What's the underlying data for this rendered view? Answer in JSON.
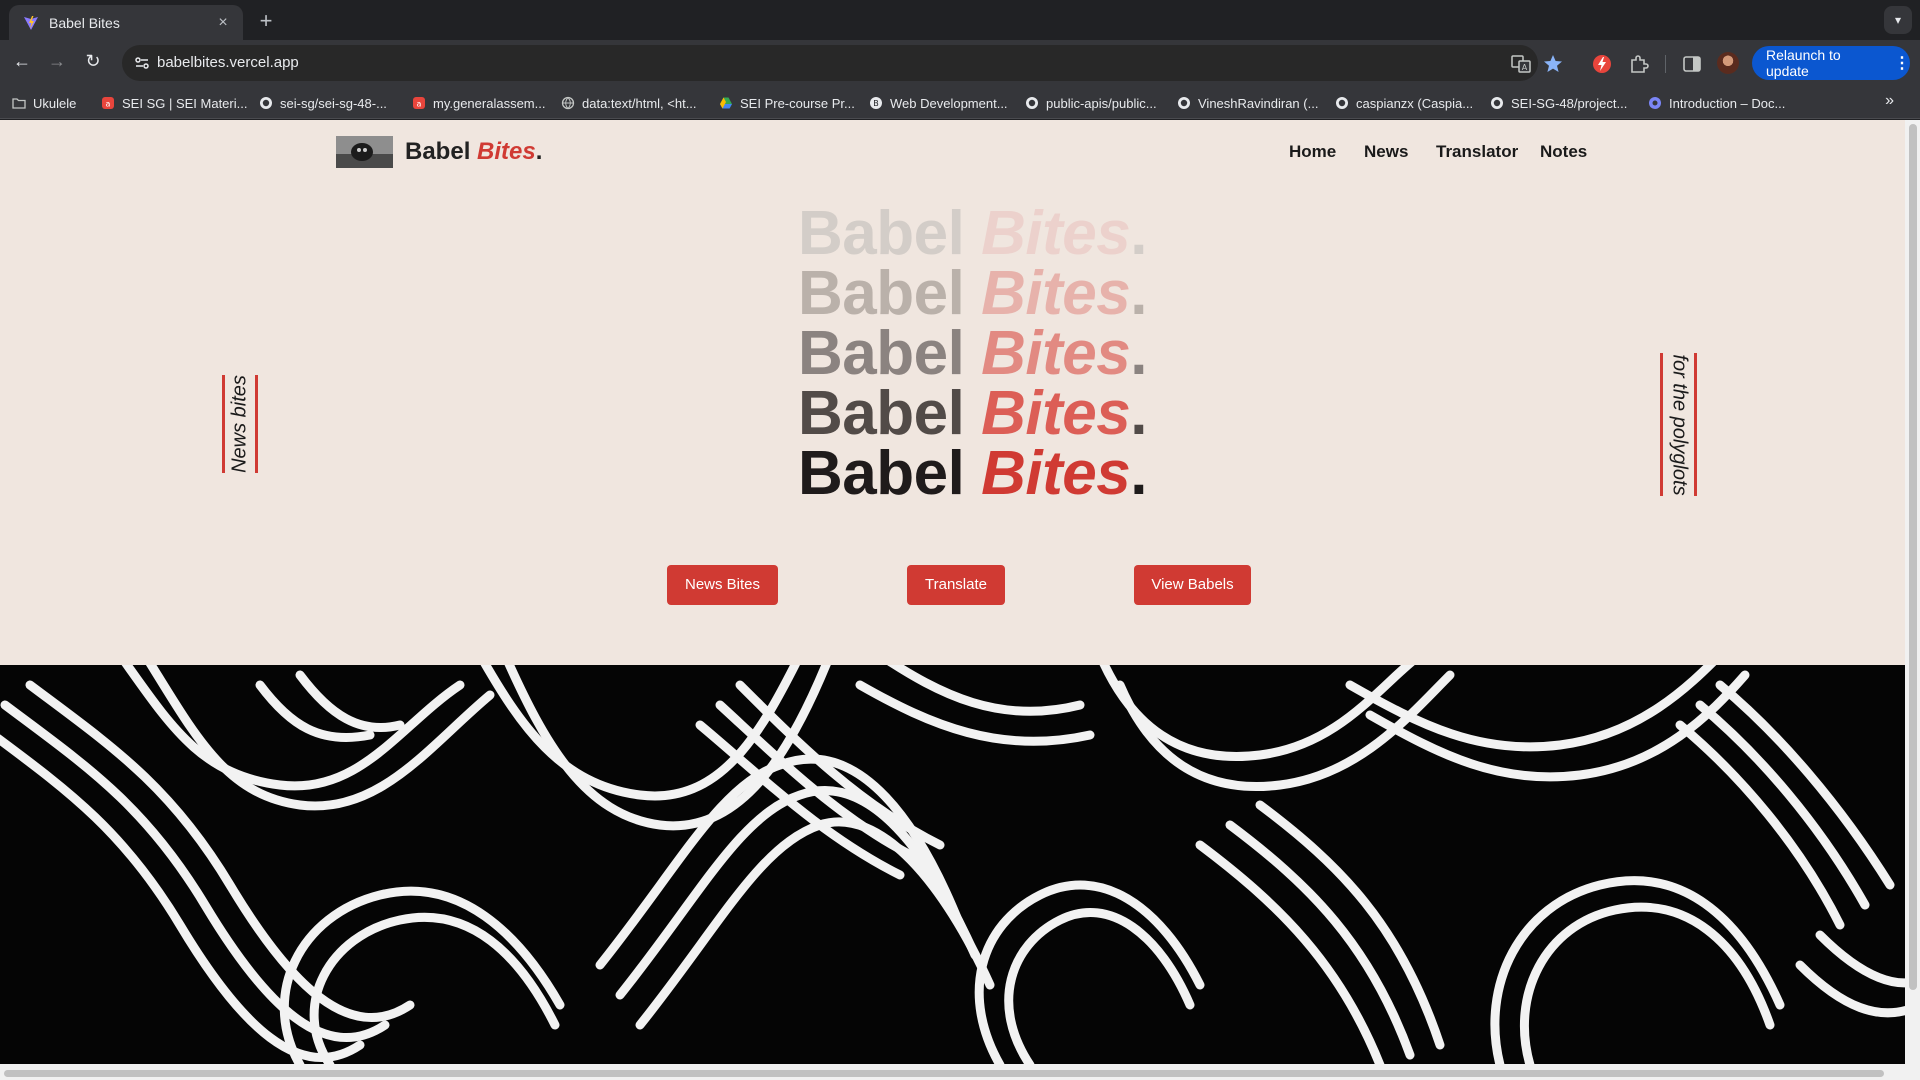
{
  "browser": {
    "tab_title": "Babel Bites",
    "tab_close": "×",
    "new_tab": "+",
    "url": "babelbites.vercel.app",
    "relaunch_label": "Relaunch to update",
    "relaunch_menu": "⋮",
    "bookmarks": [
      {
        "label": "Ukulele",
        "icon": "folder-icon"
      },
      {
        "label": "SEI SG | SEI Materi...",
        "icon": "ga-icon"
      },
      {
        "label": "sei-sg/sei-sg-48-...",
        "icon": "github-icon"
      },
      {
        "label": "my.generalassem...",
        "icon": "ga-icon"
      },
      {
        "label": "data:text/html, <ht...",
        "icon": "globe-icon"
      },
      {
        "label": "SEI Pre-course Pr...",
        "icon": "drive-icon"
      },
      {
        "label": "Web Development...",
        "icon": "badge-icon"
      },
      {
        "label": "public-apis/public...",
        "icon": "github-icon"
      },
      {
        "label": "VineshRavindiran (...",
        "icon": "github-icon"
      },
      {
        "label": "caspianzx (Caspia...",
        "icon": "github-icon"
      },
      {
        "label": "SEI-SG-48/project...",
        "icon": "github-icon"
      },
      {
        "label": "Introduction – Doc...",
        "icon": "doc-icon"
      }
    ],
    "bookmarks_overflow": "»"
  },
  "site": {
    "brand_main": "Babel",
    "brand_accent": "Bites",
    "brand_dot": ".",
    "nav": [
      "Home",
      "News",
      "Translator",
      "Notes"
    ],
    "hero": {
      "word1": "Babel",
      "word2": "Bites",
      "dot": ".",
      "lines": [
        {
          "dark": "#d3cdc8",
          "red": "#ecd1cc"
        },
        {
          "dark": "#bab1aa",
          "red": "#e7b2ab"
        },
        {
          "dark": "#8b8380",
          "red": "#e28a82"
        },
        {
          "dark": "#524b48",
          "red": "#dc5e56"
        },
        {
          "dark": "#1f1b1b",
          "red": "#d03a33"
        }
      ]
    },
    "side_left": "News bites",
    "side_right": "for the polyglots",
    "buttons": {
      "news": "News Bites",
      "translate": "Translate",
      "view": "View Babels"
    },
    "accent_color": "#d03a33",
    "background_color": "#f0e6df"
  }
}
